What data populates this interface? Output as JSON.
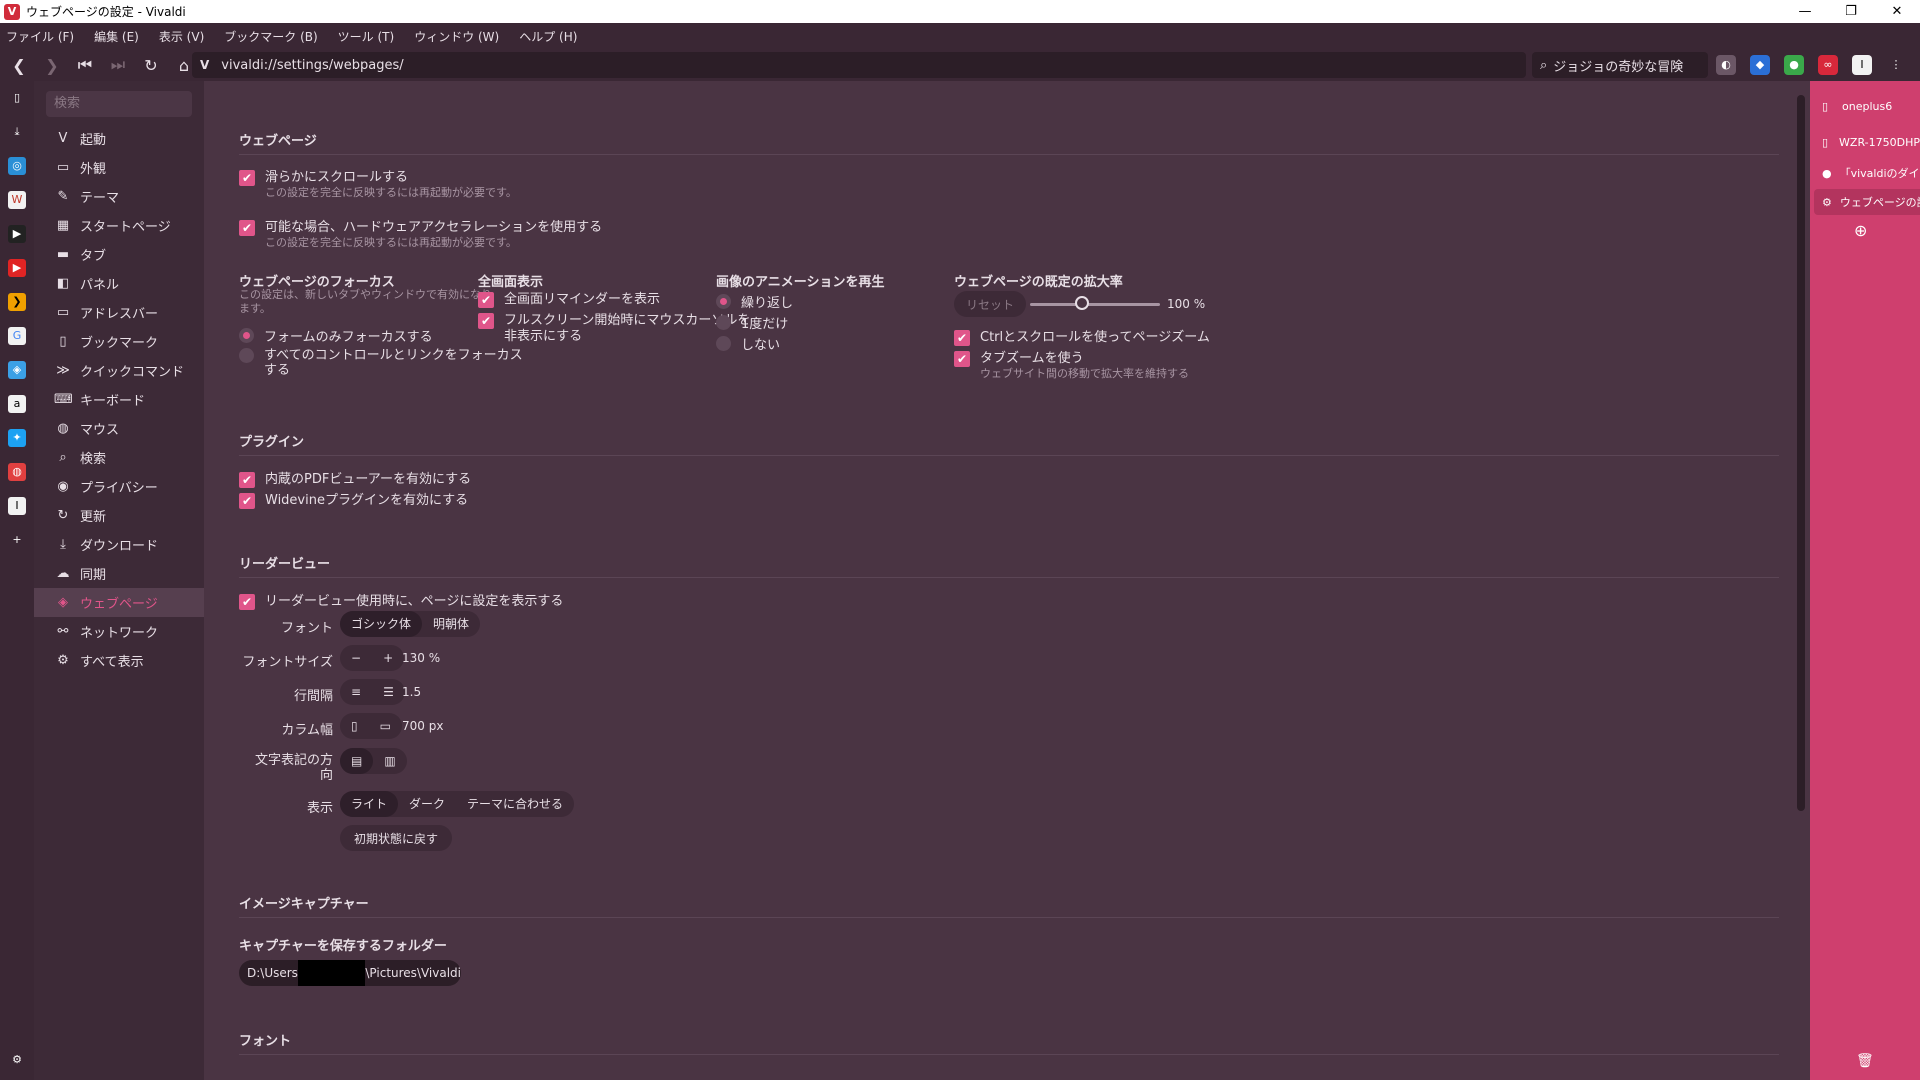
{
  "window": {
    "title": "ウェブページの設定 - Vivaldi",
    "logo": "V",
    "minimize": "—",
    "restore": "❐",
    "close": "✕"
  },
  "menu": [
    "ファイル (F)",
    "編集 (E)",
    "表示 (V)",
    "ブックマーク (B)",
    "ツール (T)",
    "ウィンドウ (W)",
    "ヘルプ (H)"
  ],
  "address": {
    "url": "vivaldi://settings/webpages/",
    "url_icon": "V",
    "search_value": "ジョジョの奇妙な冒険"
  },
  "settings_nav": {
    "search_placeholder": "検索",
    "items": [
      {
        "label": "起動",
        "icon": "V"
      },
      {
        "label": "外観",
        "icon": "▭"
      },
      {
        "label": "テーマ",
        "icon": "✎"
      },
      {
        "label": "スタートページ",
        "icon": "▦"
      },
      {
        "label": "タブ",
        "icon": "▬"
      },
      {
        "label": "パネル",
        "icon": "◧"
      },
      {
        "label": "アドレスバー",
        "icon": "▭"
      },
      {
        "label": "ブックマーク",
        "icon": "▯"
      },
      {
        "label": "クイックコマンド",
        "icon": "≫"
      },
      {
        "label": "キーボード",
        "icon": "⌨"
      },
      {
        "label": "マウス",
        "icon": "◍"
      },
      {
        "label": "検索",
        "icon": "⌕"
      },
      {
        "label": "プライバシー",
        "icon": "◉"
      },
      {
        "label": "更新",
        "icon": "↻"
      },
      {
        "label": "ダウンロード",
        "icon": "⤓"
      },
      {
        "label": "同期",
        "icon": "☁"
      },
      {
        "label": "ウェブページ",
        "icon": "◈"
      },
      {
        "label": "ネットワーク",
        "icon": "⚯"
      },
      {
        "label": "すべて表示",
        "icon": "⚙"
      }
    ],
    "active_index": 16
  },
  "webpages": {
    "title": "ウェブページ",
    "smooth_scroll": {
      "label": "滑らかにスクロールする",
      "note": "この設定を完全に反映するには再起動が必要です。"
    },
    "hw_accel": {
      "label": "可能な場合、ハードウェアアクセラレーションを使用する",
      "note": "この設定を完全に反映するには再起動が必要です。"
    },
    "focus": {
      "title": "ウェブページのフォーカス",
      "note1": "この設定は、新しいタブやウィンドウで有効になり",
      "note2": "ます。",
      "opt1": "フォームのみフォーカスする",
      "opt2a": "すべてのコントロールとリンクをフォーカス",
      "opt2b": "する"
    },
    "fullscreen": {
      "title": "全画面表示",
      "opt1": "全画面リマインダーを表示",
      "opt2a": "フルスクリーン開始時にマウスカーソルを",
      "opt2b": "非表示にする"
    },
    "animation": {
      "title": "画像のアニメーションを再生",
      "opt1": "繰り返し",
      "opt2": "1度だけ",
      "opt3": "しない"
    },
    "zoom": {
      "title": "ウェブページの既定の拡大率",
      "reset": "リセット",
      "value": "100 %",
      "level": 0.4,
      "ctrl_scroll": "Ctrlとスクロールを使ってページズーム",
      "tab_zoom": "タブズームを使う",
      "tab_zoom_note": "ウェブサイト間の移動で拡大率を維持する"
    }
  },
  "plugins": {
    "title": "プラグイン",
    "pdf": "内蔵のPDFビューアーを有効にする",
    "widevine": "Widevineプラグインを有効にする"
  },
  "reader": {
    "title": "リーダービュー",
    "show_settings": "リーダービュー使用時に、ページに設定を表示する",
    "font_label": "フォント",
    "font_gothic": "ゴシック体",
    "font_mincho": "明朝体",
    "size_label": "フォントサイズ",
    "size_minus": "−",
    "size_plus": "+",
    "size_value": "130 %",
    "line_label": "行間隔",
    "line_value": "1.5",
    "col_label": "カラム幅",
    "col_value": "700 px",
    "dir_label_a": "文字表記の方",
    "dir_label_b": "向",
    "display_label": "表示",
    "light": "ライト",
    "dark": "ダーク",
    "theme": "テーマに合わせる",
    "reset": "初期状態に戻す"
  },
  "capture": {
    "title": "イメージキャプチャー",
    "folder_title": "キャプチャーを保存するフォルダー",
    "path_a": "D:\\Users",
    "path_b": "\\Pictures\\Vivaldi"
  },
  "fonts": {
    "title": "フォント"
  },
  "tabs": [
    {
      "label": "oneplus6",
      "icon": "▯"
    },
    {
      "label": "WZR-1750DHP",
      "icon": "▯"
    },
    {
      "label": "「vivaldiのダイレ",
      "icon": "●"
    },
    {
      "label": "ウェブページの設定",
      "icon": "⚙"
    }
  ],
  "colors": {
    "accent": "#e0558a",
    "tab_panel": "#cf3f6e",
    "background": "#4a3443"
  }
}
